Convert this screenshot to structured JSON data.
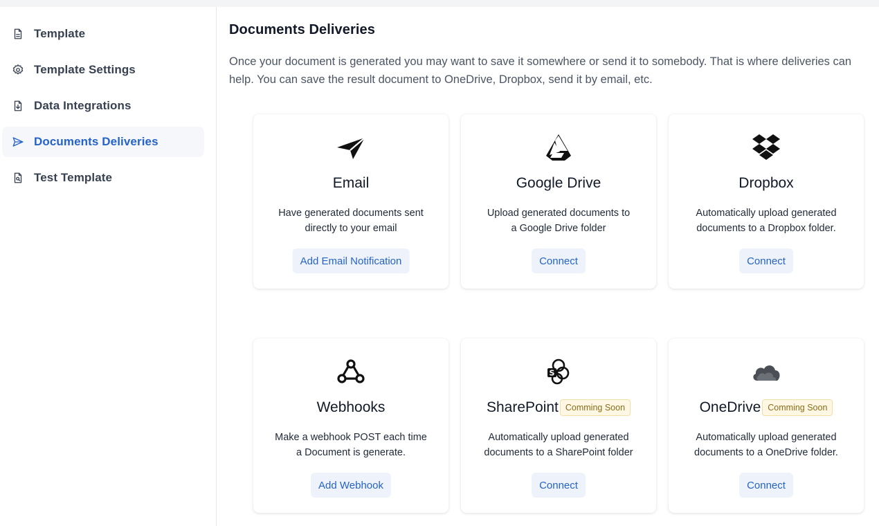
{
  "sidebar": {
    "items": [
      {
        "label": "Template",
        "icon": "document-icon",
        "active": false
      },
      {
        "label": "Template Settings",
        "icon": "gear-icon",
        "active": false
      },
      {
        "label": "Data Integrations",
        "icon": "file-download-icon",
        "active": false
      },
      {
        "label": "Documents Deliveries",
        "icon": "send-icon",
        "active": true
      },
      {
        "label": "Test Template",
        "icon": "file-search-icon",
        "active": false
      }
    ]
  },
  "main": {
    "title": "Documents Deliveries",
    "description": "Once your document is generated you may want to save it somewhere or send it to somebody. That is where deliveries can help. You can save the result document to OneDrive, Dropbox, send it by email, etc."
  },
  "cards": [
    {
      "title": "Email",
      "icon": "paper-plane-icon",
      "desc1": "Have generated documents sent",
      "desc2": "directly to your email",
      "button": "Add Email Notification",
      "badge": ""
    },
    {
      "title": "Google Drive",
      "icon": "google-drive-icon",
      "desc1": "Upload generated documents to",
      "desc2": "a Google Drive folder",
      "button": "Connect",
      "badge": ""
    },
    {
      "title": "Dropbox",
      "icon": "dropbox-icon",
      "desc1": "Automatically upload generated",
      "desc2": "documents to a Dropbox folder.",
      "button": "Connect",
      "badge": ""
    },
    {
      "title": "Webhooks",
      "icon": "webhook-icon",
      "desc1": "Make a webhook POST each time",
      "desc2": "a Document is generate.",
      "button": "Add Webhook",
      "badge": ""
    },
    {
      "title": "SharePoint",
      "icon": "sharepoint-icon",
      "desc1": "Automatically upload generated",
      "desc2": "documents to a SharePoint folder",
      "button": "Connect",
      "badge": "Comming Soon"
    },
    {
      "title": "OneDrive",
      "icon": "onedrive-icon",
      "desc1": "Automatically upload generated",
      "desc2": "documents to a OneDrive folder.",
      "button": "Connect",
      "badge": "Comming Soon"
    }
  ],
  "colors": {
    "accent": "#2563c9",
    "button_bg": "#eef3fb",
    "active_nav_bg": "#f5f7fb",
    "badge_text": "#8a6d1a",
    "badge_bg": "#fdf7e3"
  }
}
